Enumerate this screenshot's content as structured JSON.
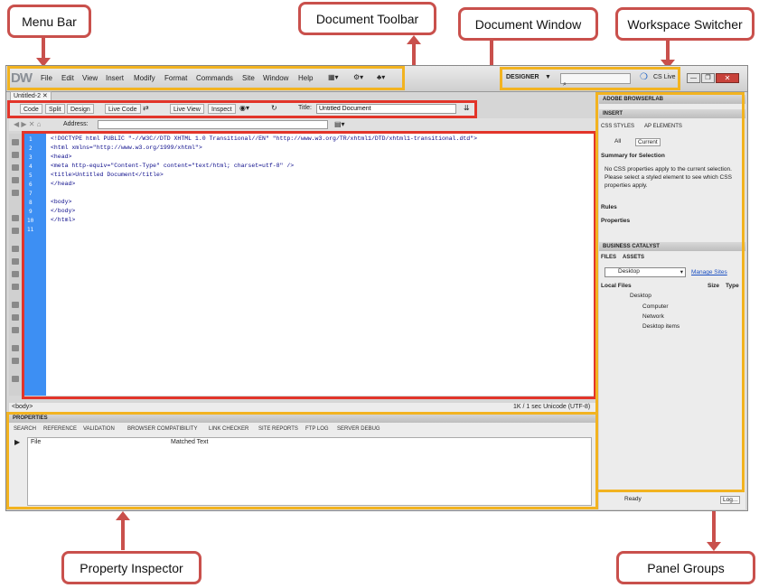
{
  "callouts": {
    "menu_bar": "Menu Bar",
    "document_toolbar": "Document Toolbar",
    "document_window": "Document Window",
    "workspace_switcher": "Workspace Switcher",
    "property_inspector": "Property Inspector",
    "panel_groups": "Panel Groups"
  },
  "app": {
    "logo": "DW",
    "menu": [
      "File",
      "Edit",
      "View",
      "Insert",
      "Modify",
      "Format",
      "Commands",
      "Site",
      "Window",
      "Help"
    ],
    "workspace": "DESIGNER",
    "cs_live": "CS Live",
    "doc_tab": "Untitled-2",
    "toolbar": {
      "code": "Code",
      "split": "Split",
      "design": "Design",
      "live_code": "Live Code",
      "live_view": "Live View",
      "inspect": "Inspect",
      "title_label": "Title:",
      "title_value": "Untitled Document"
    },
    "address_label": "Address:",
    "line_numbers": [
      "1",
      "2",
      "3",
      "4",
      "5",
      "6",
      "7",
      "8",
      "9",
      "10",
      "11"
    ],
    "code_lines": [
      "<!DOCTYPE html PUBLIC \"-//W3C//DTD XHTML 1.0 Transitional//EN\" \"http://www.w3.org/TR/xhtml1/DTD/xhtml1-transitional.dtd\">",
      "<html xmlns=\"http://www.w3.org/1999/xhtml\">",
      "<head>",
      "<meta http-equiv=\"Content-Type\" content=\"text/html; charset=utf-8\" />",
      "<title>Untitled Document</title>",
      "</head>",
      "",
      "<body>",
      "</body>",
      "</html>",
      ""
    ],
    "status_tag": "<body>",
    "status_right": "1K / 1 sec  Unicode (UTF-8)",
    "properties_label": "PROPERTIES",
    "result_tabs": [
      "SEARCH",
      "REFERENCE",
      "VALIDATION",
      "BROWSER COMPATIBILITY",
      "LINK CHECKER",
      "SITE REPORTS",
      "FTP LOG",
      "SERVER DEBUG"
    ],
    "result_cols": [
      "File",
      "Matched Text"
    ],
    "panels": {
      "browserlab": "ADOBE BROWSERLAB",
      "insert": "INSERT",
      "css_tab": "CSS STYLES",
      "ap_tab": "AP ELEMENTS",
      "all": "All",
      "current": "Current",
      "summary": "Summary for Selection",
      "no_css": "No CSS properties apply to the current selection.  Please select a styled element to see which CSS properties apply.",
      "rules": "Rules",
      "properties": "Properties",
      "business": "BUSINESS CATALYST",
      "files_tab": "FILES",
      "assets_tab": "ASSETS",
      "site_select": "Desktop",
      "manage_sites": "Manage Sites",
      "local_files": "Local Files",
      "size": "Size",
      "type": "Type",
      "tree": [
        "Desktop",
        "Computer",
        "Network",
        "Desktop items"
      ],
      "ready": "Ready",
      "log": "Log..."
    }
  },
  "colors": {
    "callout_border": "#c9504c",
    "highlight_orange": "#f2b320",
    "highlight_red": "#e2352a",
    "gutter": "#3d8ff3"
  }
}
